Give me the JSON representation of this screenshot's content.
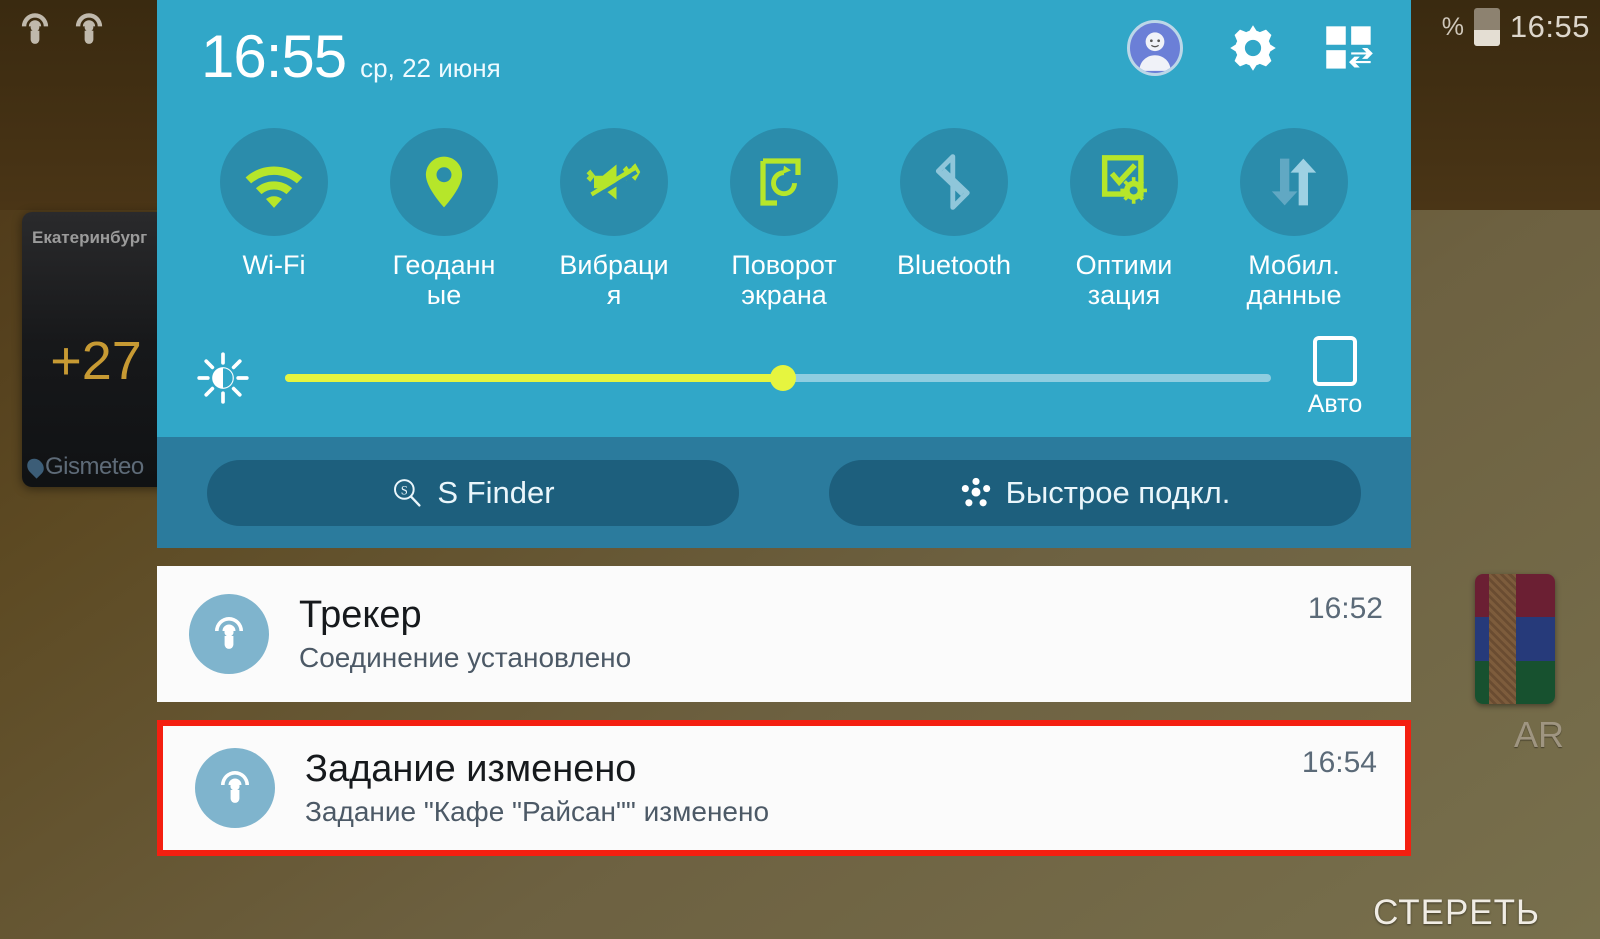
{
  "statusbar": {
    "left_icons": [
      "tracker-icon",
      "tracker-icon"
    ],
    "battery_percent_symbol": "%",
    "time": "16:55"
  },
  "home": {
    "weather_widget": {
      "city": "Екатеринбург",
      "temperature": "+27",
      "brand": "Gismeteo"
    },
    "folder_label": "AR",
    "clear_button": "СТЕРЕТЬ"
  },
  "panel": {
    "clock": {
      "time": "16:55",
      "date": "ср, 22 июня"
    },
    "header_actions": [
      {
        "name": "user-avatar",
        "label": "avatar-icon"
      },
      {
        "name": "settings",
        "label": "gear-icon"
      },
      {
        "name": "edit-toggles",
        "label": "edit-grid-icon"
      }
    ],
    "toggles": [
      {
        "label": "Wi-Fi",
        "icon": "wifi-icon",
        "active": true
      },
      {
        "label": "Геоданные",
        "icon": "location-pin-icon",
        "active": true
      },
      {
        "label": "Вибраци я",
        "icon": "vibrate-mute-icon",
        "active": true
      },
      {
        "label": "Поворот экрана",
        "icon": "screen-rotation-icon",
        "active": true
      },
      {
        "label": "Bluetooth",
        "icon": "bluetooth-icon",
        "active": false
      },
      {
        "label": "Оптими зация",
        "icon": "optimization-icon",
        "active": true
      },
      {
        "label": "Мобил. данные",
        "icon": "mobile-data-icon",
        "active": false
      }
    ],
    "brightness": {
      "icon": "brightness-icon",
      "value_percent": 50,
      "auto_label": "Авто",
      "auto_checked": false
    },
    "actions": [
      {
        "label": "S Finder",
        "icon": "s-finder-search-icon"
      },
      {
        "label": "Быстрое подкл.",
        "icon": "quick-connect-icon"
      }
    ],
    "colors": {
      "header": "#31a7c8",
      "actions_band": "#2b7b9d",
      "pill": "#1d5f7d",
      "toggle_circle": "#2b8cab",
      "accent_green": "#b6e62a",
      "slider_yellow": "#e6f53f",
      "highlight_red": "#f41f10"
    }
  },
  "notifications": [
    {
      "icon": "tracker-icon",
      "title": "Трекер",
      "text": "Соединение установлено",
      "time": "16:52",
      "highlighted": false
    },
    {
      "icon": "tracker-icon",
      "title": "Задание изменено",
      "text": "Задание \"Кафе \"Райсан\"\" изменено",
      "time": "16:54",
      "highlighted": true
    }
  ]
}
